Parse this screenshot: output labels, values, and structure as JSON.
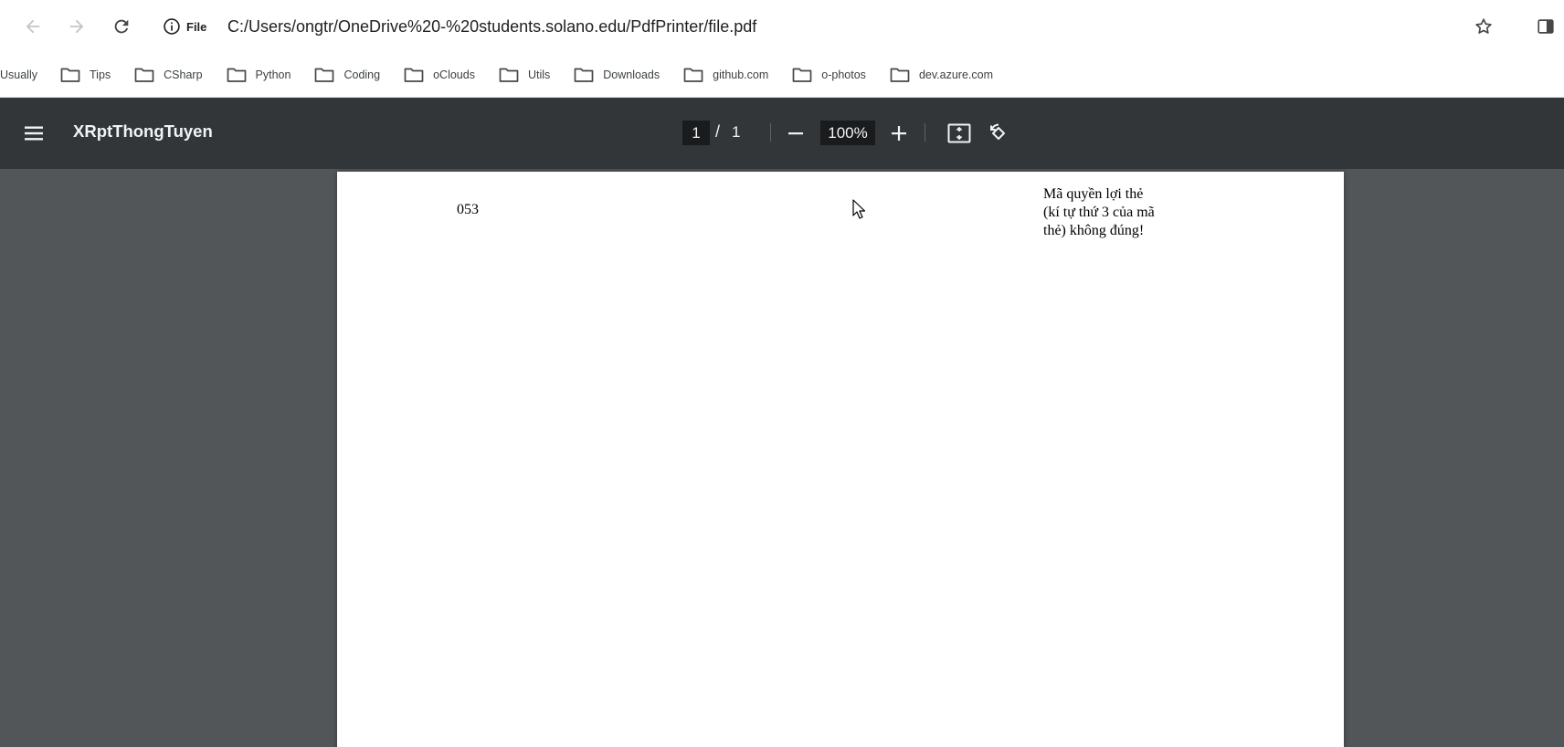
{
  "browser": {
    "site_info_label": "File",
    "url": "C:/Users/ongtr/OneDrive%20-%20students.solano.edu/PdfPrinter/file.pdf",
    "icons": {
      "back": "arrow-left-icon",
      "forward": "arrow-right-icon",
      "reload": "reload-icon",
      "site_info": "info-icon",
      "bookmark_star": "star-icon",
      "side_panel": "side-panel-icon"
    }
  },
  "bookmarks": {
    "items": [
      {
        "label": "Usually",
        "icon": "none"
      },
      {
        "label": "Tips",
        "icon": "folder-icon"
      },
      {
        "label": "CSharp",
        "icon": "folder-icon"
      },
      {
        "label": "Python",
        "icon": "folder-icon"
      },
      {
        "label": "Coding",
        "icon": "folder-icon"
      },
      {
        "label": "oClouds",
        "icon": "folder-icon"
      },
      {
        "label": "Utils",
        "icon": "folder-icon"
      },
      {
        "label": "Downloads",
        "icon": "folder-icon"
      },
      {
        "label": "github.com",
        "icon": "folder-icon"
      },
      {
        "label": "o-photos",
        "icon": "folder-icon"
      },
      {
        "label": "dev.azure.com",
        "icon": "folder-icon"
      }
    ]
  },
  "pdf_toolbar": {
    "title": "XRptThongTuyen",
    "current_page": "1",
    "page_separator": "/",
    "total_pages": "1",
    "zoom": "100%",
    "icons": {
      "menu": "menu-icon",
      "zoom_out": "minus-icon",
      "zoom_in": "plus-icon",
      "fit": "fit-to-page-icon",
      "rotate": "rotate-icon"
    }
  },
  "document": {
    "code": "053",
    "message": "Mã quyền lợi thẻ (kí tự thứ 3 của mã thẻ) không đúng!"
  },
  "colors": {
    "pdf_toolbar_bg": "#323639",
    "viewer_bg": "#525659",
    "input_box_bg": "#191b1c"
  }
}
